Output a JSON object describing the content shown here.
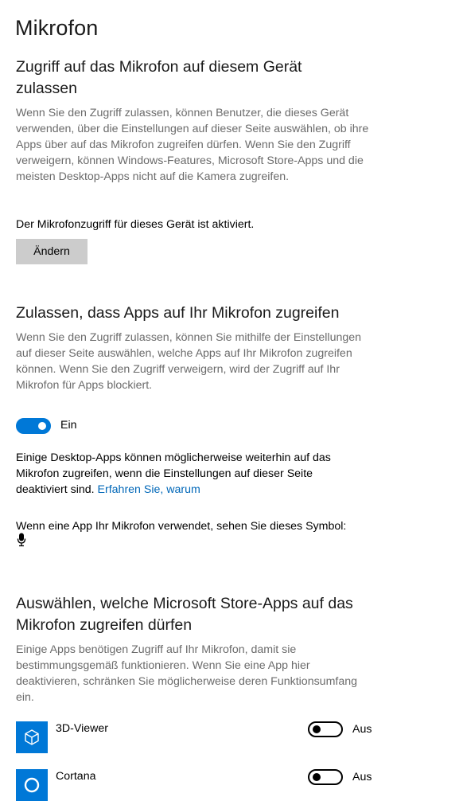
{
  "page": {
    "title": "Mikrofon"
  },
  "device_access": {
    "heading": "Zugriff auf das Mikrofon auf diesem Gerät zulassen",
    "description": "Wenn Sie den Zugriff zulassen, können Benutzer, die dieses Gerät verwenden, über die Einstellungen auf dieser Seite auswählen, ob ihre Apps über auf das Mikrofon zugreifen dürfen. Wenn Sie den Zugriff verweigern, können Windows-Features, Microsoft Store-Apps und die meisten Desktop-Apps nicht auf die Kamera zugreifen.",
    "status": "Der Mikrofonzugriff für dieses Gerät ist aktiviert.",
    "change_button": "Ändern"
  },
  "app_access": {
    "heading": "Zulassen, dass Apps auf Ihr Mikrofon zugreifen",
    "description": "Wenn Sie den Zugriff zulassen, können Sie mithilfe der Einstellungen auf dieser Seite auswählen, welche Apps auf Ihr Mikrofon zugreifen können. Wenn Sie den Zugriff verweigern, wird der Zugriff auf Ihr Mikrofon für Apps blockiert.",
    "toggle_state": "on",
    "toggle_label": "Ein",
    "desktop_note": "Einige Desktop-Apps können möglicherweise weiterhin auf das Mikrofon zugreifen, wenn die Einstellungen auf dieser Seite deaktiviert sind.",
    "learn_more_link": "Erfahren Sie, warum",
    "symbol_note": "Wenn eine App Ihr Mikrofon verwendet, sehen Sie dieses Symbol:",
    "symbol_icon": "microphone-icon"
  },
  "store_apps": {
    "heading": "Auswählen, welche Microsoft Store-Apps auf das Mikrofon zugreifen dürfen",
    "description": "Einige Apps benötigen Zugriff auf Ihr Mikrofon, damit sie bestimmungsgemäß funktionieren. Wenn Sie eine App hier deaktivieren, schränken Sie möglicherweise deren Funktionsumfang ein.",
    "apps": [
      {
        "name": "3D-Viewer",
        "icon": "cube-icon",
        "toggle_state": "off",
        "toggle_label": "Aus"
      },
      {
        "name": "Cortana",
        "icon": "cortana-circle-icon",
        "toggle_state": "off",
        "toggle_label": "Aus"
      }
    ]
  },
  "colors": {
    "accent": "#0078d7",
    "link": "#0067b8",
    "description_text": "#6b6b6b",
    "button_bg": "#cccccc"
  }
}
